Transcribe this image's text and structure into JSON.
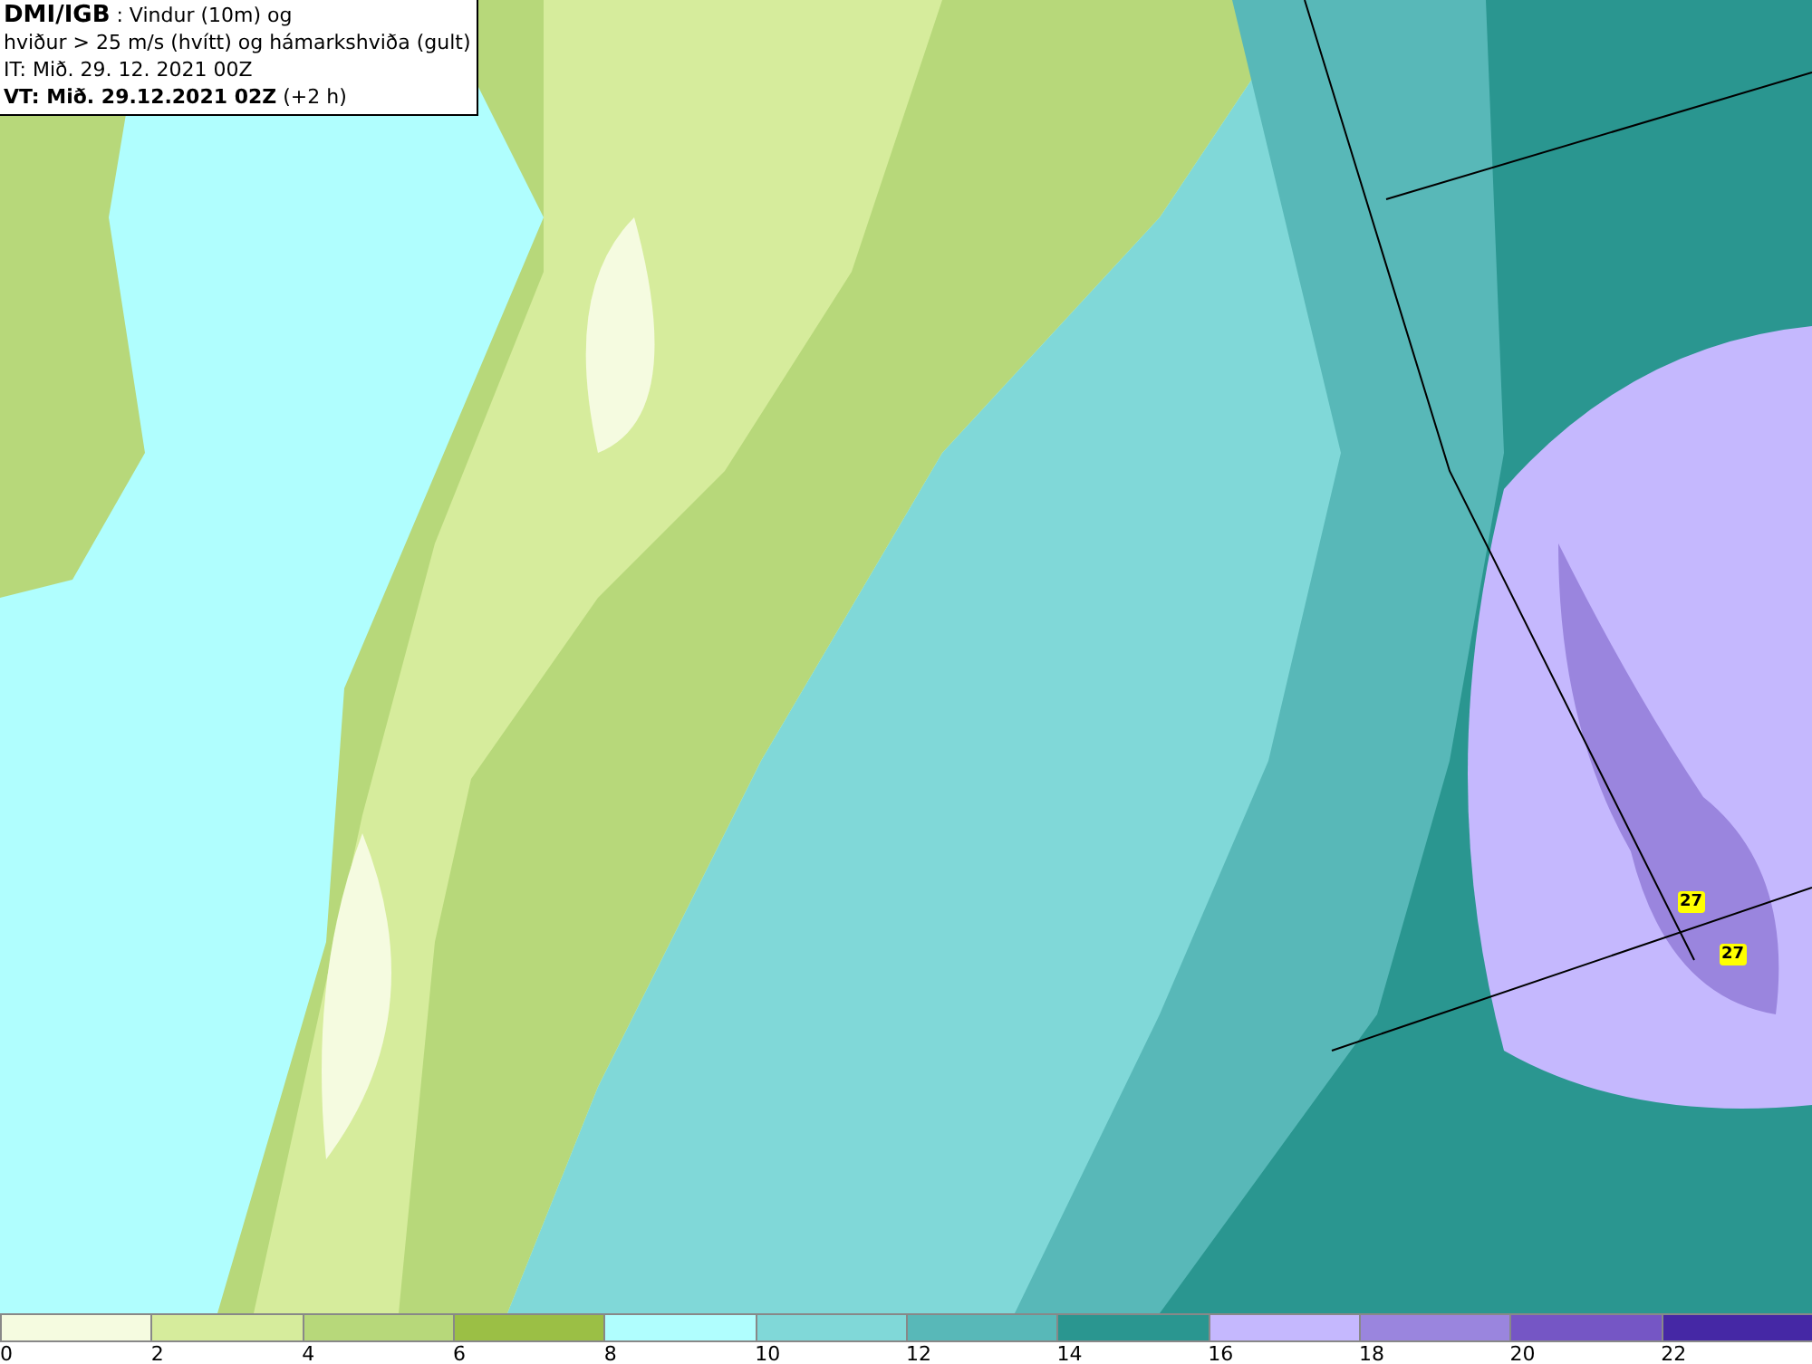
{
  "header": {
    "lines": [
      "**DMI/IGB** : Vindur (10m) og",
      "hviður > 25 m/s (hvítt) og hámarkshviða (gult)",
      "IT: Mið. 29. 12. 2021 00Z",
      "**VT: Mið. 29.12.2021 02Z** (+2 h)"
    ]
  },
  "map": {
    "gust_labels": [
      "27",
      "27"
    ]
  },
  "legend": {
    "bins": [
      {
        "label": "0",
        "color": "#f5fbe0"
      },
      {
        "label": "2",
        "color": "#d6ec9c"
      },
      {
        "label": "4",
        "color": "#b7d87a"
      },
      {
        "label": "6",
        "color": "#9bbf45"
      },
      {
        "label": "8",
        "color": "#b0fefe"
      },
      {
        "label": "10",
        "color": "#80d8d8"
      },
      {
        "label": "12",
        "color": "#58b8b8"
      },
      {
        "label": "14",
        "color": "#2a9690"
      },
      {
        "label": "16",
        "color": "#c5b8fe"
      },
      {
        "label": "18",
        "color": "#9a85de"
      },
      {
        "label": "20",
        "color": "#7556c5"
      },
      {
        "label": "22",
        "color": "#4528a5"
      }
    ]
  }
}
